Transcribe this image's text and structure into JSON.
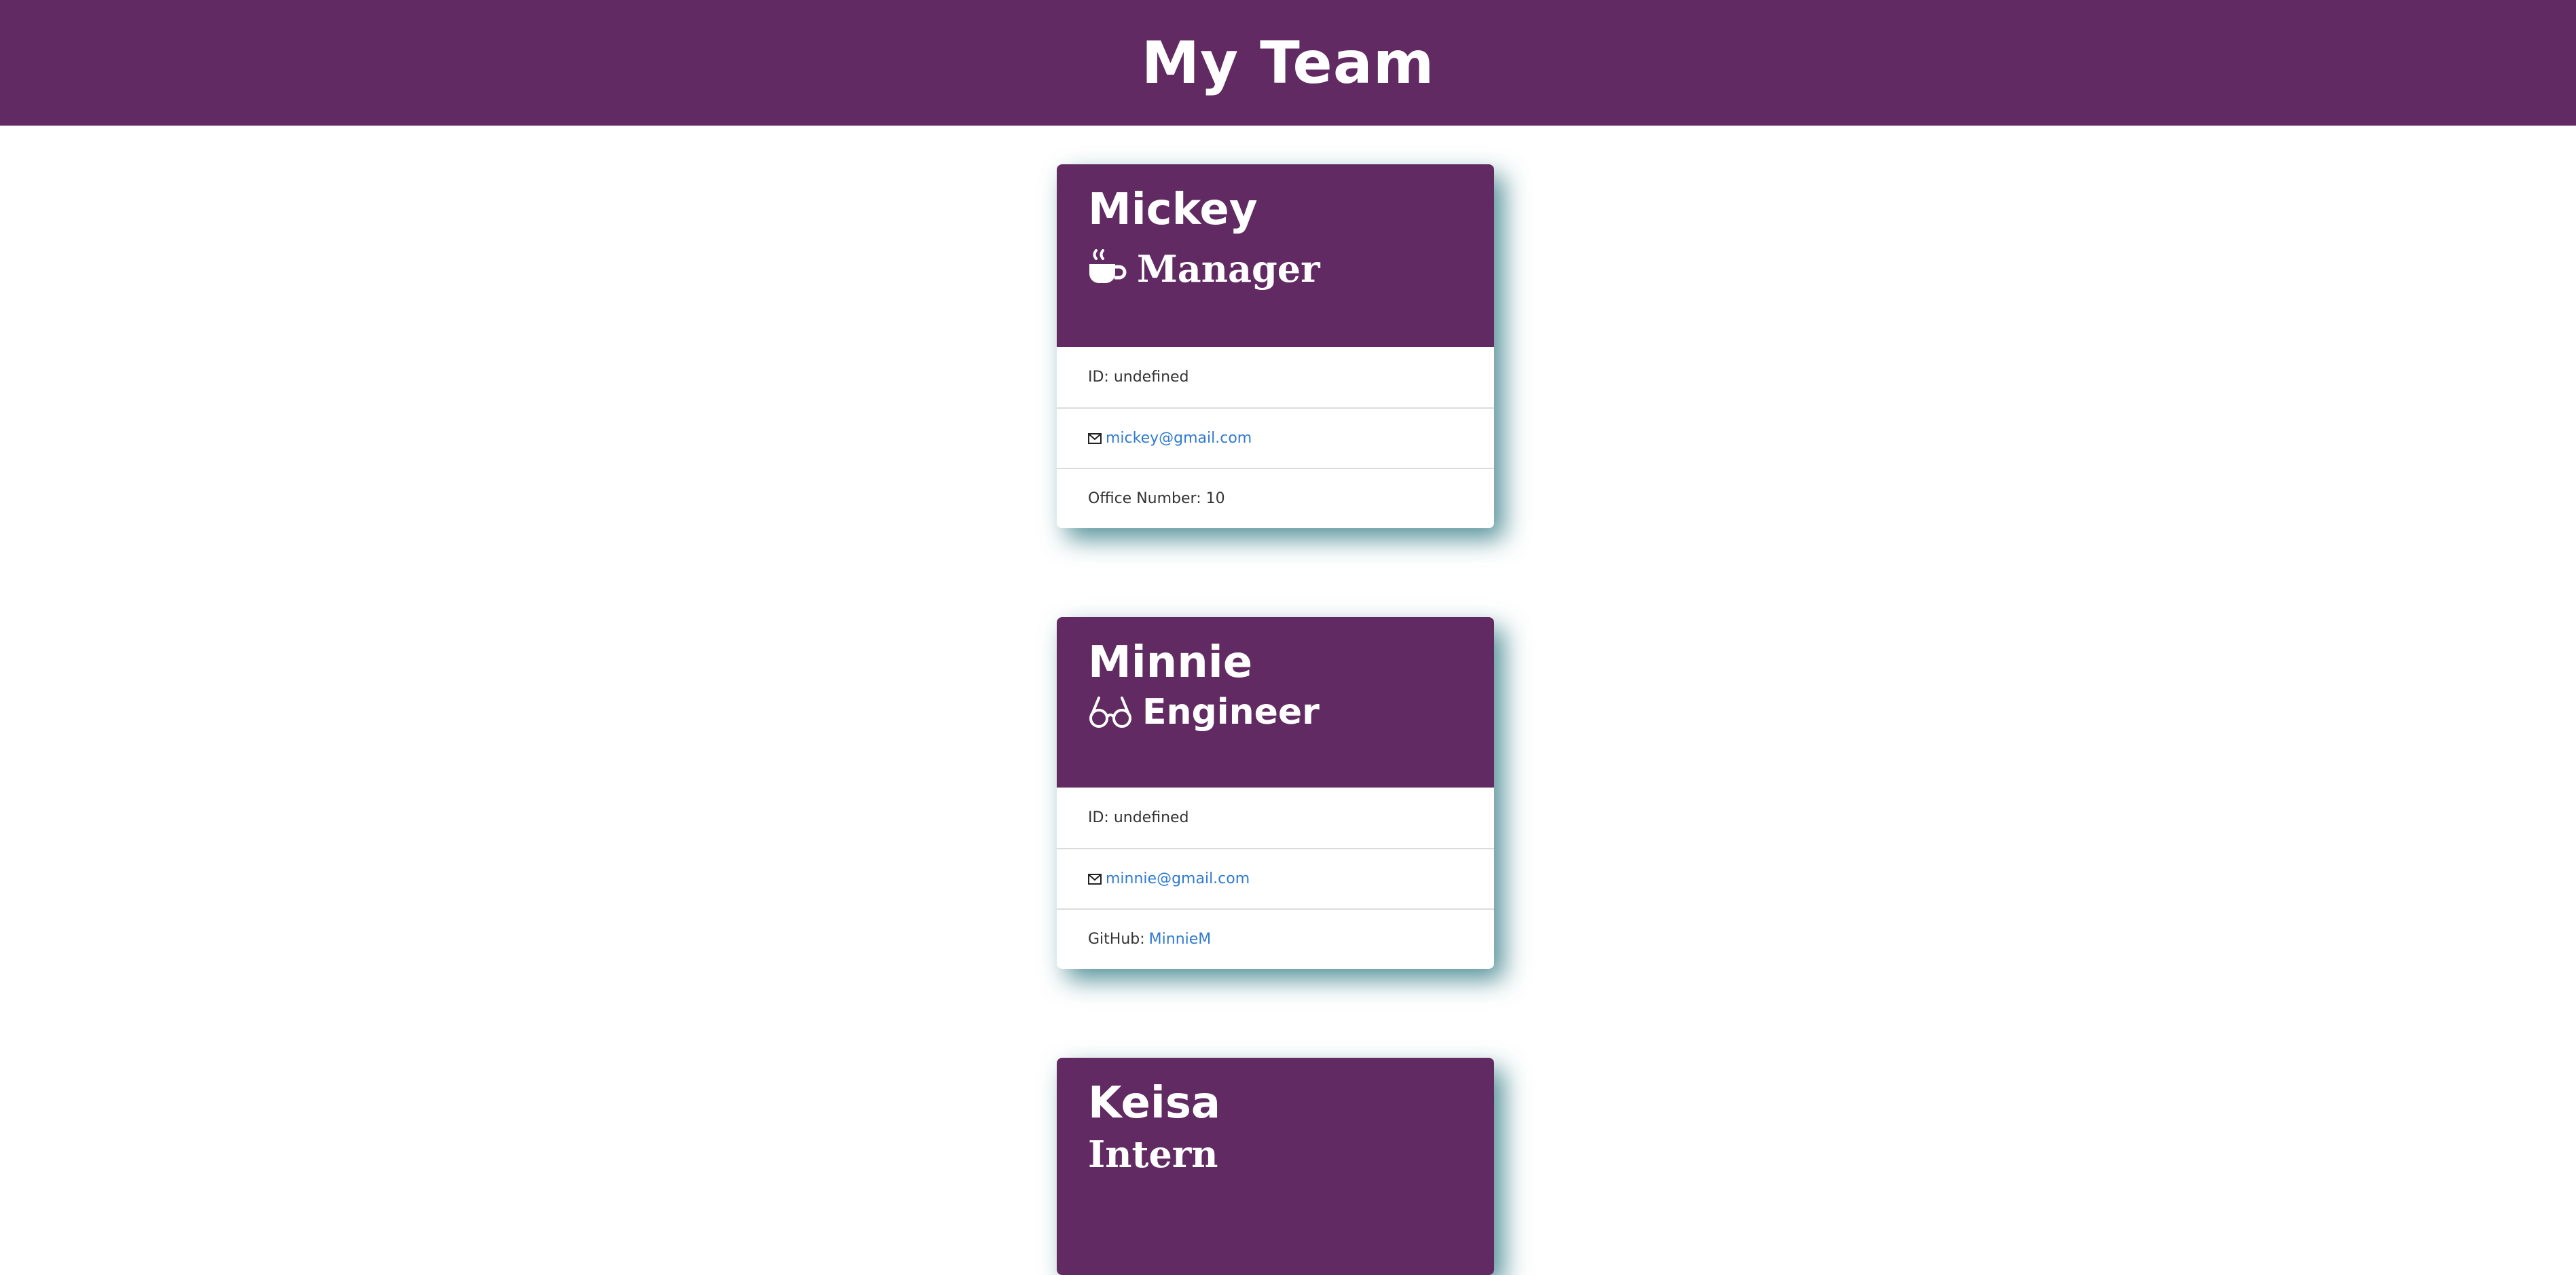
{
  "header": {
    "title": "My Team"
  },
  "team": [
    {
      "name": "Mickey",
      "role": "Manager",
      "role_icon": "coffee-icon",
      "id_text": "ID: undefined",
      "email": "mickey@gmail.com",
      "extra_label": "Office Number: 10"
    },
    {
      "name": "Minnie",
      "role": "Engineer",
      "role_icon": "glasses-icon",
      "id_text": "ID: undefined",
      "email": "minnie@gmail.com",
      "extra_label": "GitHub:",
      "extra_link": "MinnieM"
    },
    {
      "name": "Keisa",
      "role": "Intern"
    }
  ],
  "colors": {
    "brand": "#612a62",
    "link": "#2f7ad0",
    "shadow": "#1e6e78"
  }
}
